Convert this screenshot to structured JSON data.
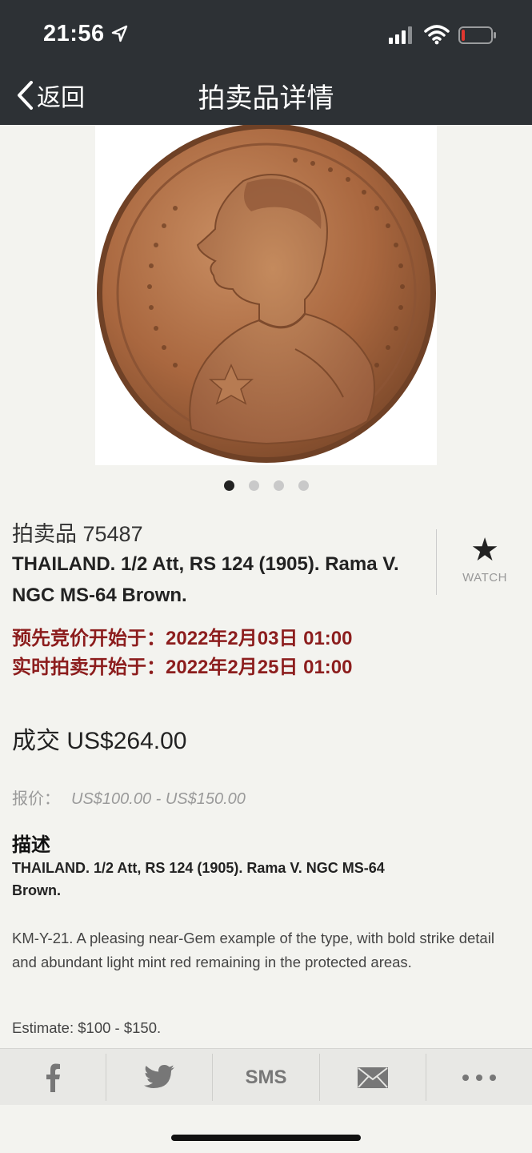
{
  "status_bar": {
    "time": "21:56"
  },
  "nav": {
    "back_label": "返回",
    "title": "拍卖品详情"
  },
  "gallery": {
    "pages": 4,
    "active_index": 0
  },
  "lot": {
    "number": "拍卖品 75487",
    "title": "THAILAND. 1/2 Att, RS 124 (1905). Rama V. NGC MS-64 Brown.",
    "watch_label": "WATCH",
    "presale_start": "预先竞价开始于：2022年2月03日 01:00",
    "live_start": "实时拍卖开始于：2022年2月25日 01:00",
    "sold": "成交 US$264.00",
    "estimate_label": "报价：",
    "estimate_value": "US$100.00 - US$150.00"
  },
  "description": {
    "heading": "描述",
    "title": "THAILAND. 1/2 Att, RS 124 (1905). Rama V. NGC MS-64 Brown.",
    "body": "KM-Y-21. A pleasing near-Gem example of the type, with bold strike detail and abundant light mint red remaining in the protected areas.",
    "estimate": "Estimate: $100 - $150."
  },
  "share": {
    "sms_label": "SMS"
  },
  "colors": {
    "header_bg": "#2d3135",
    "date_red": "#8c1d1d",
    "page_bg": "#f3f3ef"
  }
}
